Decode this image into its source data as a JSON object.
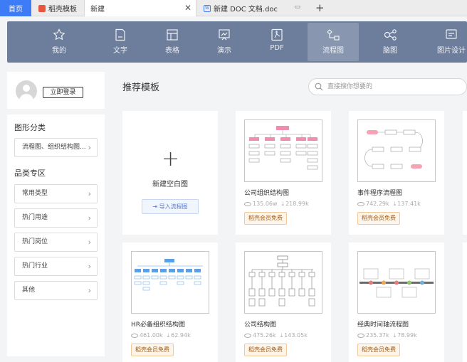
{
  "tabs": {
    "home": "首页",
    "t1": "稻壳模板",
    "t2": "新建",
    "t3": "新建 DOC 文档.doc",
    "close": "✕",
    "add": "+"
  },
  "nav": {
    "categories": [
      {
        "label": "我的",
        "icon": "star-icon"
      },
      {
        "label": "文字",
        "icon": "document-icon"
      },
      {
        "label": "表格",
        "icon": "table-icon"
      },
      {
        "label": "演示",
        "icon": "presentation-icon"
      },
      {
        "label": "PDF",
        "icon": "pdf-icon"
      },
      {
        "label": "流程图",
        "icon": "flowchart-icon",
        "active": true
      },
      {
        "label": "脑图",
        "icon": "mindmap-icon"
      },
      {
        "label": "图片设计",
        "icon": "image-design-icon"
      }
    ]
  },
  "user": {
    "login": "立即登录"
  },
  "sidebar": {
    "section1_title": "图形分类",
    "section1_item": "流程图、组织结构图...",
    "section2_title": "品类专区",
    "items": [
      "常用类型",
      "热门用途",
      "热门岗位",
      "热门行业",
      "其他"
    ]
  },
  "main": {
    "title": "推荐模板",
    "search_placeholder": "直接搜你想要的",
    "new_blank": "新建空白图",
    "import": "导入流程图"
  },
  "templates": [
    {
      "name": "公司组织结构图",
      "views": "135.06w",
      "downloads": "218.99k",
      "badge": "稻壳会员免费"
    },
    {
      "name": "事件程序流程图",
      "views": "742.29k",
      "downloads": "137.41k",
      "badge": "稻壳会员免费"
    },
    {
      "name": "HR必备组织结构图",
      "views": "461.00k",
      "downloads": "62.94k",
      "badge": "稻壳会员免费"
    },
    {
      "name": "公司结构图",
      "views": "475.26k",
      "downloads": "143.05k",
      "badge": "稻壳会员免费"
    },
    {
      "name": "经典时间轴流程图",
      "views": "235.37k",
      "downloads": "78.99k",
      "badge": "稻壳会员免费"
    }
  ],
  "colors": {
    "accent": "#3d7cf6",
    "nav_bg": "#6d7d9c",
    "nav_active": "#8896b0"
  }
}
